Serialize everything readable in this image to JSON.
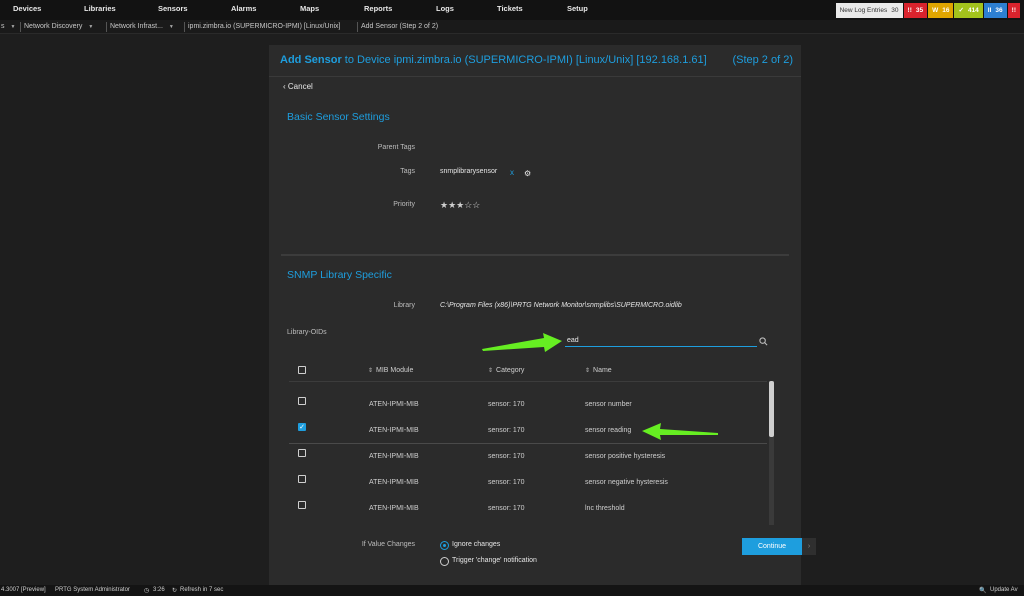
{
  "nav": {
    "items": [
      "Devices",
      "Libraries",
      "Sensors",
      "Alarms",
      "Maps",
      "Reports",
      "Logs",
      "Tickets",
      "Setup"
    ],
    "new_log_label": "New Log Entries",
    "new_log_count": "30",
    "badges": [
      {
        "icon": "!!",
        "count": "35",
        "color": "#d9232d"
      },
      {
        "icon": "W",
        "count": "16",
        "color": "#e0a500"
      },
      {
        "icon": "✓",
        "count": "414",
        "color": "#a3c31c"
      },
      {
        "icon": "II",
        "count": "36",
        "color": "#2d7fd1"
      },
      {
        "icon": "!!",
        "count": "",
        "color": "#d9232d"
      }
    ]
  },
  "breadcrumb": {
    "items": [
      "s",
      "Network Discovery",
      "Network Infrast...",
      "ipmi.zimbra.io (SUPERMICRO-IPMI) [Linux/Unix]",
      "Add Sensor (Step 2 of 2)"
    ]
  },
  "panel": {
    "title_bold": "Add Sensor",
    "title_rest": " to Device ipmi.zimbra.io (SUPERMICRO-IPMI) [Linux/Unix] [192.168.1.61]",
    "step": "(Step 2 of 2)",
    "cancel": "Cancel",
    "basic_title": "Basic Sensor Settings",
    "parent_tags_label": "Parent Tags",
    "tags_label": "Tags",
    "tag_value": "snmplibrarysensor",
    "tag_remove": "x",
    "priority_label": "Priority",
    "priority_stars": "★★★☆☆",
    "snmp_title": "SNMP Library Specific",
    "library_label": "Library",
    "library_value": "C:\\Program Files (x86)\\PRTG Network Monitor\\snmplibs\\SUPERMICRO.oidlib",
    "oids_label": "Library-OIDs",
    "search_value": "ead",
    "columns": [
      "MIB Module",
      "Category",
      "Name"
    ],
    "rows": [
      {
        "mib": "ATEN-IPMI-MIB",
        "category": "sensor: 170",
        "name": "sensor number",
        "checked": false
      },
      {
        "mib": "ATEN-IPMI-MIB",
        "category": "sensor: 170",
        "name": "sensor reading",
        "checked": true
      },
      {
        "mib": "ATEN-IPMI-MIB",
        "category": "sensor: 170",
        "name": "sensor positive hysteresis",
        "checked": false
      },
      {
        "mib": "ATEN-IPMI-MIB",
        "category": "sensor: 170",
        "name": "sensor negative hysteresis",
        "checked": false
      },
      {
        "mib": "ATEN-IPMI-MIB",
        "category": "sensor: 170",
        "name": "lnc threshold",
        "checked": false
      }
    ],
    "if_value_label": "If Value Changes",
    "radio_options": [
      "Ignore changes",
      "Trigger 'change' notification"
    ],
    "radio_selected": 0,
    "continue": "Continue",
    "continue_arrow": "›"
  },
  "footer": {
    "version": "4.3007 [Preview]",
    "user": "PRTG System Administrator",
    "time": "3:26",
    "refresh": "Refresh in 7 sec",
    "update": "Update Av"
  },
  "colors": {
    "accent": "#1e9ede",
    "annotation_arrow": "#66ee22"
  }
}
